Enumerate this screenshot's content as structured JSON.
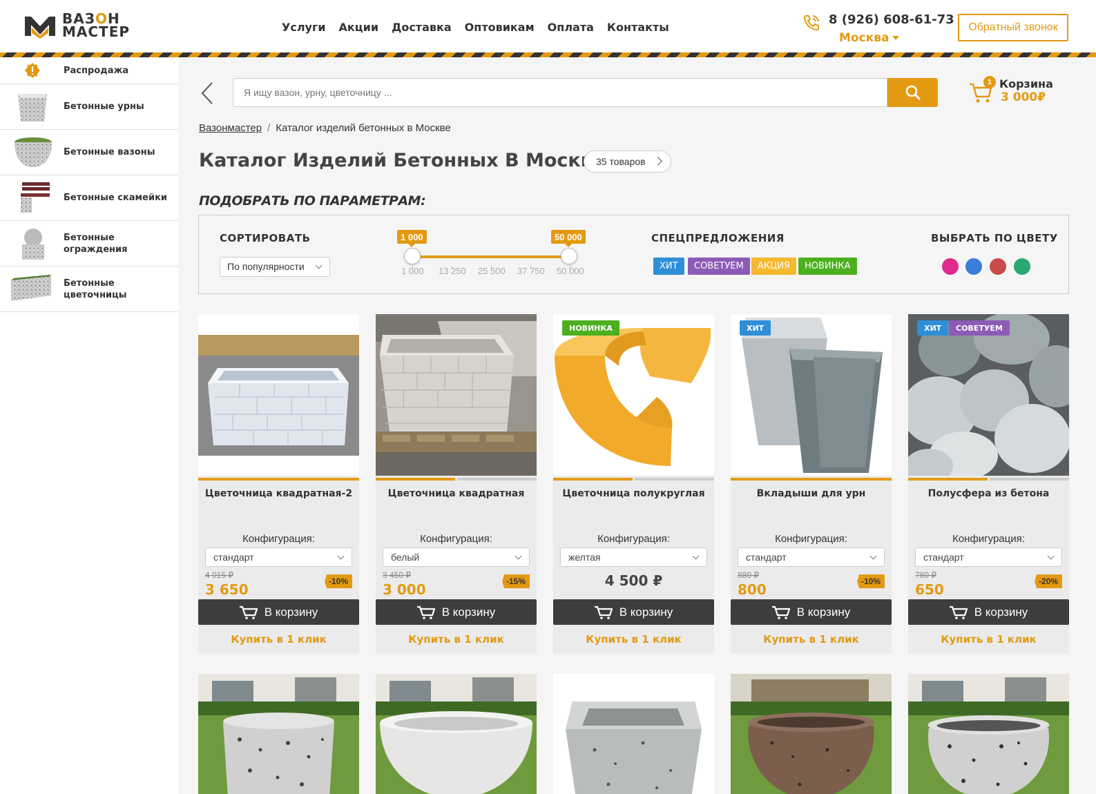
{
  "header": {
    "logo_line1_a": "ВАЗ",
    "logo_line1_o": "О",
    "logo_line1_b": "Н",
    "logo_line2": "МАСТЕР",
    "nav": [
      "Услуги",
      "Акции",
      "Доставка",
      "Оптовикам",
      "Оплата",
      "Контакты"
    ],
    "phone": "8 (926) 608-61-73",
    "city": "Москва",
    "callback_label": "Обратный звонок"
  },
  "sidebar": {
    "items": [
      {
        "label": "Распродажа",
        "icon": "sale-icon"
      },
      {
        "label": "Бетонные урны",
        "icon": "urn-thumbnail"
      },
      {
        "label": "Бетонные вазоны",
        "icon": "vase-thumbnail"
      },
      {
        "label": "Бетонные скамейки",
        "icon": "bench-thumbnail"
      },
      {
        "label_1": "Бетонные",
        "label_2": "ограждения",
        "icon": "barrier-thumbnail"
      },
      {
        "label_1": "Бетонные",
        "label_2": "цветочницы",
        "icon": "planter-thumbnail"
      }
    ]
  },
  "search": {
    "placeholder": "Я ищу вазон, урну, цветочницу ..."
  },
  "cart": {
    "count": "1",
    "title": "Корзина",
    "sum": "3 000₽"
  },
  "breadcrumb": {
    "home": "Вазонмастер",
    "separator": "/",
    "current": "Каталог изделий бетонных в Москве"
  },
  "page": {
    "title": "Каталог Изделий Бетонных В Москве",
    "count": "35 товаров"
  },
  "filters": {
    "heading": "ПОДОБРАТЬ ПО ПАРАМЕТРАМ:",
    "sort_label": "СОРТИРОВАТЬ",
    "sort_value": "По популярности",
    "price_min": "1 000",
    "price_max": "50 000",
    "ticks": [
      "1 000",
      "13 250",
      "25 500",
      "37 750",
      "50 000"
    ],
    "special_label": "СПЕЦПРЕДЛОЖЕНИЯ",
    "special_tags": [
      {
        "label": "ХИТ",
        "color": "#2e8fd8"
      },
      {
        "label": "СОВЕТУЕМ",
        "color": "#8b5bb5"
      },
      {
        "label": "АКЦИЯ",
        "color": "#f5b82e"
      },
      {
        "label": "НОВИНКА",
        "color": "#4caf1f"
      }
    ],
    "color_label": "ВЫБРАТЬ ПО ЦВЕТУ",
    "colors": [
      "#e02a8c",
      "#3a7ed8",
      "#c94a4a",
      "#2aa872"
    ]
  },
  "products": [
    {
      "name": "Цветочница квадратная-2",
      "config_label": "Конфигурация:",
      "config": "стандарт",
      "old_price": "4 015 ₽",
      "price": "3 650",
      "discount": "-10%",
      "cart_label": "В корзину",
      "oneclick": "Купить в 1 клик"
    },
    {
      "name": "Цветочница квадратная",
      "config_label": "Конфигурация:",
      "config": "белый",
      "old_price": "3 450 ₽",
      "price": "3 000",
      "discount": "-15%",
      "cart_label": "В корзину",
      "oneclick": "Купить в 1 клик"
    },
    {
      "name": "Цветочница полукруглая",
      "config_label": "Конфигурация:",
      "config": "желтая",
      "price_plain": "4 500 ₽",
      "badges": [
        "НОВИНКА"
      ],
      "cart_label": "В корзину",
      "oneclick": "Купить в 1 клик"
    },
    {
      "name": "Вкладыши для урн",
      "config_label": "Конфигурация:",
      "config": "стандарт",
      "old_price": "880 ₽",
      "price": "800",
      "discount": "-10%",
      "badges": [
        "ХИТ"
      ],
      "cart_label": "В корзину",
      "oneclick": "Купить в 1 клик"
    },
    {
      "name": "Полусфера из бетона",
      "config_label": "Конфигурация:",
      "config": "стандарт",
      "old_price": "780 ₽",
      "price": "650",
      "discount": "-20%",
      "badges": [
        "ХИТ",
        "СОВЕТУЕМ"
      ],
      "cart_label": "В корзину",
      "oneclick": "Купить в 1 клик"
    }
  ],
  "colors": {
    "accent": "#e39a12",
    "dark": "#3d3d3d"
  }
}
